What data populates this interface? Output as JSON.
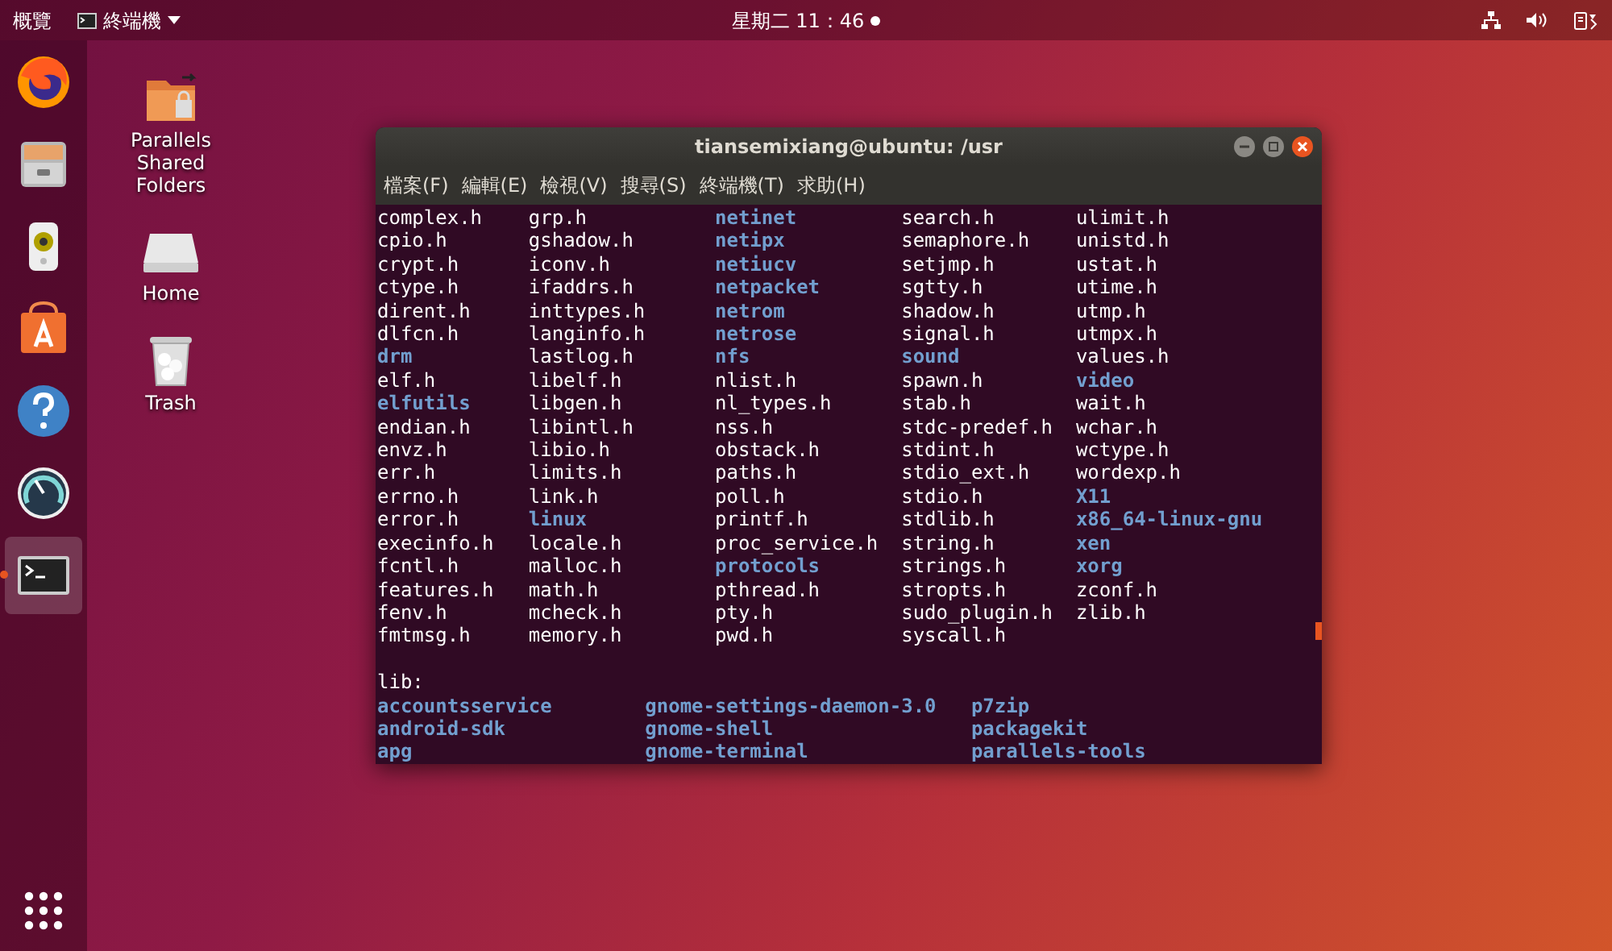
{
  "top_bar": {
    "activities": "概覽",
    "app_menu": "終端機",
    "clock": "星期二 11：46",
    "notification": true
  },
  "dock": [
    {
      "kind": "browser",
      "running": false
    },
    {
      "kind": "files",
      "running": false
    },
    {
      "kind": "speaker",
      "running": false
    },
    {
      "kind": "store",
      "running": false
    },
    {
      "kind": "help",
      "running": false
    },
    {
      "kind": "gauge",
      "running": false
    },
    {
      "kind": "terminal",
      "running": true
    }
  ],
  "desktop_icons": [
    {
      "kind": "shared-folder",
      "label": "Parallels Shared Folders"
    },
    {
      "kind": "drive",
      "label": "Home"
    },
    {
      "kind": "trash",
      "label": "Trash"
    }
  ],
  "terminal": {
    "title": "tiansemixiang@ubuntu: /usr",
    "menu": [
      "檔案(F)",
      "編輯(E)",
      "檢視(V)",
      "搜尋(S)",
      "終端機(T)",
      "求助(H)"
    ],
    "listing": [
      [
        {
          "name": "complex.h",
          "kind": "file"
        },
        {
          "name": "grp.h",
          "kind": "file"
        },
        {
          "name": "netinet",
          "kind": "dir"
        },
        {
          "name": "search.h",
          "kind": "file"
        },
        {
          "name": "ulimit.h",
          "kind": "file"
        }
      ],
      [
        {
          "name": "cpio.h",
          "kind": "file"
        },
        {
          "name": "gshadow.h",
          "kind": "file"
        },
        {
          "name": "netipx",
          "kind": "dir"
        },
        {
          "name": "semaphore.h",
          "kind": "file"
        },
        {
          "name": "unistd.h",
          "kind": "file"
        }
      ],
      [
        {
          "name": "crypt.h",
          "kind": "file"
        },
        {
          "name": "iconv.h",
          "kind": "file"
        },
        {
          "name": "netiucv",
          "kind": "dir"
        },
        {
          "name": "setjmp.h",
          "kind": "file"
        },
        {
          "name": "ustat.h",
          "kind": "file"
        }
      ],
      [
        {
          "name": "ctype.h",
          "kind": "file"
        },
        {
          "name": "ifaddrs.h",
          "kind": "file"
        },
        {
          "name": "netpacket",
          "kind": "dir"
        },
        {
          "name": "sgtty.h",
          "kind": "file"
        },
        {
          "name": "utime.h",
          "kind": "file"
        }
      ],
      [
        {
          "name": "dirent.h",
          "kind": "file"
        },
        {
          "name": "inttypes.h",
          "kind": "file"
        },
        {
          "name": "netrom",
          "kind": "dir"
        },
        {
          "name": "shadow.h",
          "kind": "file"
        },
        {
          "name": "utmp.h",
          "kind": "file"
        }
      ],
      [
        {
          "name": "dlfcn.h",
          "kind": "file"
        },
        {
          "name": "langinfo.h",
          "kind": "file"
        },
        {
          "name": "netrose",
          "kind": "dir"
        },
        {
          "name": "signal.h",
          "kind": "file"
        },
        {
          "name": "utmpx.h",
          "kind": "file"
        }
      ],
      [
        {
          "name": "drm",
          "kind": "dir"
        },
        {
          "name": "lastlog.h",
          "kind": "file"
        },
        {
          "name": "nfs",
          "kind": "dir"
        },
        {
          "name": "sound",
          "kind": "dir"
        },
        {
          "name": "values.h",
          "kind": "file"
        }
      ],
      [
        {
          "name": "elf.h",
          "kind": "file"
        },
        {
          "name": "libelf.h",
          "kind": "file"
        },
        {
          "name": "nlist.h",
          "kind": "file"
        },
        {
          "name": "spawn.h",
          "kind": "file"
        },
        {
          "name": "video",
          "kind": "dir"
        }
      ],
      [
        {
          "name": "elfutils",
          "kind": "dir"
        },
        {
          "name": "libgen.h",
          "kind": "file"
        },
        {
          "name": "nl_types.h",
          "kind": "file"
        },
        {
          "name": "stab.h",
          "kind": "file"
        },
        {
          "name": "wait.h",
          "kind": "file"
        }
      ],
      [
        {
          "name": "endian.h",
          "kind": "file"
        },
        {
          "name": "libintl.h",
          "kind": "file"
        },
        {
          "name": "nss.h",
          "kind": "file"
        },
        {
          "name": "stdc-predef.h",
          "kind": "file"
        },
        {
          "name": "wchar.h",
          "kind": "file"
        }
      ],
      [
        {
          "name": "envz.h",
          "kind": "file"
        },
        {
          "name": "libio.h",
          "kind": "file"
        },
        {
          "name": "obstack.h",
          "kind": "file"
        },
        {
          "name": "stdint.h",
          "kind": "file"
        },
        {
          "name": "wctype.h",
          "kind": "file"
        }
      ],
      [
        {
          "name": "err.h",
          "kind": "file"
        },
        {
          "name": "limits.h",
          "kind": "file"
        },
        {
          "name": "paths.h",
          "kind": "file"
        },
        {
          "name": "stdio_ext.h",
          "kind": "file"
        },
        {
          "name": "wordexp.h",
          "kind": "file"
        }
      ],
      [
        {
          "name": "errno.h",
          "kind": "file"
        },
        {
          "name": "link.h",
          "kind": "file"
        },
        {
          "name": "poll.h",
          "kind": "file"
        },
        {
          "name": "stdio.h",
          "kind": "file"
        },
        {
          "name": "X11",
          "kind": "dir"
        }
      ],
      [
        {
          "name": "error.h",
          "kind": "file"
        },
        {
          "name": "linux",
          "kind": "dir"
        },
        {
          "name": "printf.h",
          "kind": "file"
        },
        {
          "name": "stdlib.h",
          "kind": "file"
        },
        {
          "name": "x86_64-linux-gnu",
          "kind": "dir"
        }
      ],
      [
        {
          "name": "execinfo.h",
          "kind": "file"
        },
        {
          "name": "locale.h",
          "kind": "file"
        },
        {
          "name": "proc_service.h",
          "kind": "file"
        },
        {
          "name": "string.h",
          "kind": "file"
        },
        {
          "name": "xen",
          "kind": "dir"
        }
      ],
      [
        {
          "name": "fcntl.h",
          "kind": "file"
        },
        {
          "name": "malloc.h",
          "kind": "file"
        },
        {
          "name": "protocols",
          "kind": "dir"
        },
        {
          "name": "strings.h",
          "kind": "file"
        },
        {
          "name": "xorg",
          "kind": "dir"
        }
      ],
      [
        {
          "name": "features.h",
          "kind": "file"
        },
        {
          "name": "math.h",
          "kind": "file"
        },
        {
          "name": "pthread.h",
          "kind": "file"
        },
        {
          "name": "stropts.h",
          "kind": "file"
        },
        {
          "name": "zconf.h",
          "kind": "file"
        }
      ],
      [
        {
          "name": "fenv.h",
          "kind": "file"
        },
        {
          "name": "mcheck.h",
          "kind": "file"
        },
        {
          "name": "pty.h",
          "kind": "file"
        },
        {
          "name": "sudo_plugin.h",
          "kind": "file"
        },
        {
          "name": "zlib.h",
          "kind": "file"
        }
      ],
      [
        {
          "name": "fmtmsg.h",
          "kind": "file"
        },
        {
          "name": "memory.h",
          "kind": "file"
        },
        {
          "name": "pwd.h",
          "kind": "file"
        },
        {
          "name": "syscall.h",
          "kind": "file"
        }
      ]
    ],
    "lib_heading": "lib:",
    "lib_listing": [
      [
        {
          "name": "accountsservice",
          "kind": "dir"
        },
        {
          "name": "gnome-settings-daemon-3.0",
          "kind": "dir"
        },
        {
          "name": "p7zip",
          "kind": "dir"
        }
      ],
      [
        {
          "name": "android-sdk",
          "kind": "dir"
        },
        {
          "name": "gnome-shell",
          "kind": "dir"
        },
        {
          "name": "packagekit",
          "kind": "dir"
        }
      ],
      [
        {
          "name": "apg",
          "kind": "dir"
        },
        {
          "name": "gnome-terminal",
          "kind": "dir"
        },
        {
          "name": "parallels-tools",
          "kind": "dir"
        }
      ]
    ]
  }
}
